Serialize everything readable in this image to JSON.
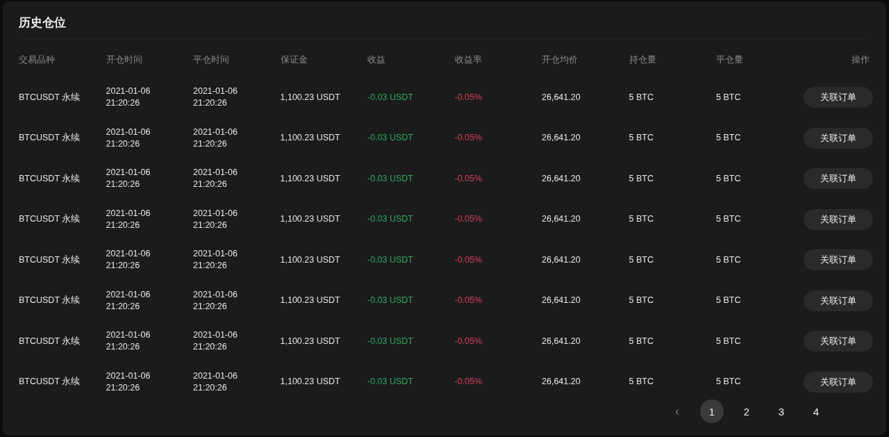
{
  "title": "历史仓位",
  "columns": [
    {
      "label": "交易品种",
      "kind": "text"
    },
    {
      "label": "开仓时间",
      "kind": "text"
    },
    {
      "label": "平仓时间",
      "kind": "text"
    },
    {
      "label": "保证金",
      "kind": "text"
    },
    {
      "label": "收益",
      "kind": "gain"
    },
    {
      "label": "收益率",
      "kind": "loss"
    },
    {
      "label": "开仓均价",
      "kind": "text"
    },
    {
      "label": "持仓量",
      "kind": "text"
    },
    {
      "label": "平仓量",
      "kind": "text"
    },
    {
      "label": "操作",
      "kind": "action"
    }
  ],
  "rows": [
    {
      "cells": [
        "BTCUSDT 永续",
        "2021-01-06\n21:20:26",
        "2021-01-06\n21:20:26",
        "1,100.23 USDT",
        "-0.03 USDT",
        "-0.05%",
        "26,641.20",
        "5 BTC",
        "5 BTC",
        "关联订单"
      ]
    },
    {
      "cells": [
        "BTCUSDT 永续",
        "2021-01-06\n21:20:26",
        "2021-01-06\n21:20:26",
        "1,100.23 USDT",
        "-0.03 USDT",
        "-0.05%",
        "26,641.20",
        "5 BTC",
        "5 BTC",
        "关联订单"
      ]
    },
    {
      "cells": [
        "BTCUSDT 永续",
        "2021-01-06\n21:20:26",
        "2021-01-06\n21:20:26",
        "1,100.23 USDT",
        "-0.03 USDT",
        "-0.05%",
        "26,641.20",
        "5 BTC",
        "5 BTC",
        "关联订单"
      ]
    },
    {
      "cells": [
        "BTCUSDT 永续",
        "2021-01-06\n21:20:26",
        "2021-01-06\n21:20:26",
        "1,100.23 USDT",
        "-0.03 USDT",
        "-0.05%",
        "26,641.20",
        "5 BTC",
        "5 BTC",
        "关联订单"
      ]
    },
    {
      "cells": [
        "BTCUSDT 永续",
        "2021-01-06\n21:20:26",
        "2021-01-06\n21:20:26",
        "1,100.23 USDT",
        "-0.03 USDT",
        "-0.05%",
        "26,641.20",
        "5 BTC",
        "5 BTC",
        "关联订单"
      ]
    },
    {
      "cells": [
        "BTCUSDT 永续",
        "2021-01-06\n21:20:26",
        "2021-01-06\n21:20:26",
        "1,100.23 USDT",
        "-0.03 USDT",
        "-0.05%",
        "26,641.20",
        "5 BTC",
        "5 BTC",
        "关联订单"
      ]
    },
    {
      "cells": [
        "BTCUSDT 永续",
        "2021-01-06\n21:20:26",
        "2021-01-06\n21:20:26",
        "1,100.23 USDT",
        "-0.03 USDT",
        "-0.05%",
        "26,641.20",
        "5 BTC",
        "5 BTC",
        "关联订单"
      ]
    },
    {
      "cells": [
        "BTCUSDT 永续",
        "2021-01-06\n21:20:26",
        "2021-01-06\n21:20:26",
        "1,100.23 USDT",
        "-0.03 USDT",
        "-0.05%",
        "26,641.20",
        "5 BTC",
        "5 BTC",
        "关联订单"
      ]
    }
  ],
  "pagination": {
    "prev": "‹",
    "pages": [
      {
        "label": "1",
        "selected": true
      },
      {
        "label": "2",
        "selected": false
      },
      {
        "label": "3",
        "selected": false
      },
      {
        "label": "4",
        "selected": false
      }
    ]
  }
}
